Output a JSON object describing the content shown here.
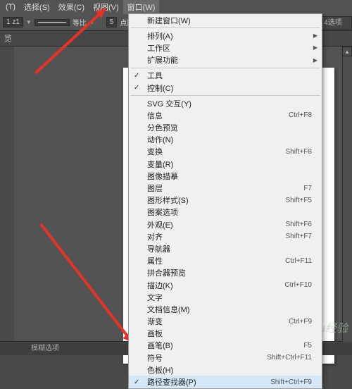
{
  "menubar": {
    "items": [
      {
        "label": "(T)"
      },
      {
        "label": "选择(S)"
      },
      {
        "label": "效果(C)"
      },
      {
        "label": "视图(V)"
      },
      {
        "label": "窗口(W)"
      }
    ],
    "open_index": 4
  },
  "toolbar": {
    "zoom": "1 z1",
    "scale_mode": "等比",
    "points": "5",
    "shape_label": "点圆形"
  },
  "secondbar": {
    "tab": "览"
  },
  "right_edge_label": "4选项",
  "statusbar": {
    "text": "模糊选项"
  },
  "watermark": "Baidu经验",
  "dropdown": {
    "groups": [
      [
        {
          "label": "新建窗口(W)",
          "shortcut": ""
        }
      ],
      [
        {
          "label": "排列(A)",
          "sub": true
        },
        {
          "label": "工作区",
          "sub": true
        },
        {
          "label": "扩展功能",
          "sub": true
        }
      ],
      [
        {
          "label": "工具",
          "checked": true
        },
        {
          "label": "控制(C)",
          "checked": true
        }
      ],
      [
        {
          "label": "SVG 交互(Y)"
        },
        {
          "label": "信息",
          "shortcut": "Ctrl+F8"
        },
        {
          "label": "分色预览"
        },
        {
          "label": "动作(N)"
        },
        {
          "label": "变换",
          "shortcut": "Shift+F8"
        },
        {
          "label": "变量(R)"
        },
        {
          "label": "图像描摹"
        },
        {
          "label": "图层",
          "shortcut": "F7"
        },
        {
          "label": "图形样式(S)",
          "shortcut": "Shift+F5"
        },
        {
          "label": "图案选项"
        },
        {
          "label": "外观(E)",
          "shortcut": "Shift+F6"
        },
        {
          "label": "对齐",
          "shortcut": "Shift+F7"
        },
        {
          "label": "导航器"
        },
        {
          "label": "属性",
          "shortcut": "Ctrl+F11"
        },
        {
          "label": "拼合器预览"
        },
        {
          "label": "描边(K)",
          "shortcut": "Ctrl+F10"
        },
        {
          "label": "文字"
        },
        {
          "label": "文档信息(M)"
        },
        {
          "label": "渐变",
          "shortcut": "Ctrl+F9"
        },
        {
          "label": "画板"
        },
        {
          "label": "画笔(B)",
          "shortcut": "F5"
        },
        {
          "label": "符号",
          "shortcut": "Shift+Ctrl+F11"
        },
        {
          "label": "色板(H)"
        },
        {
          "label": "路径查找器(P)",
          "shortcut": "Shift+Ctrl+F9",
          "checked": true,
          "highlight": true
        }
      ]
    ]
  }
}
